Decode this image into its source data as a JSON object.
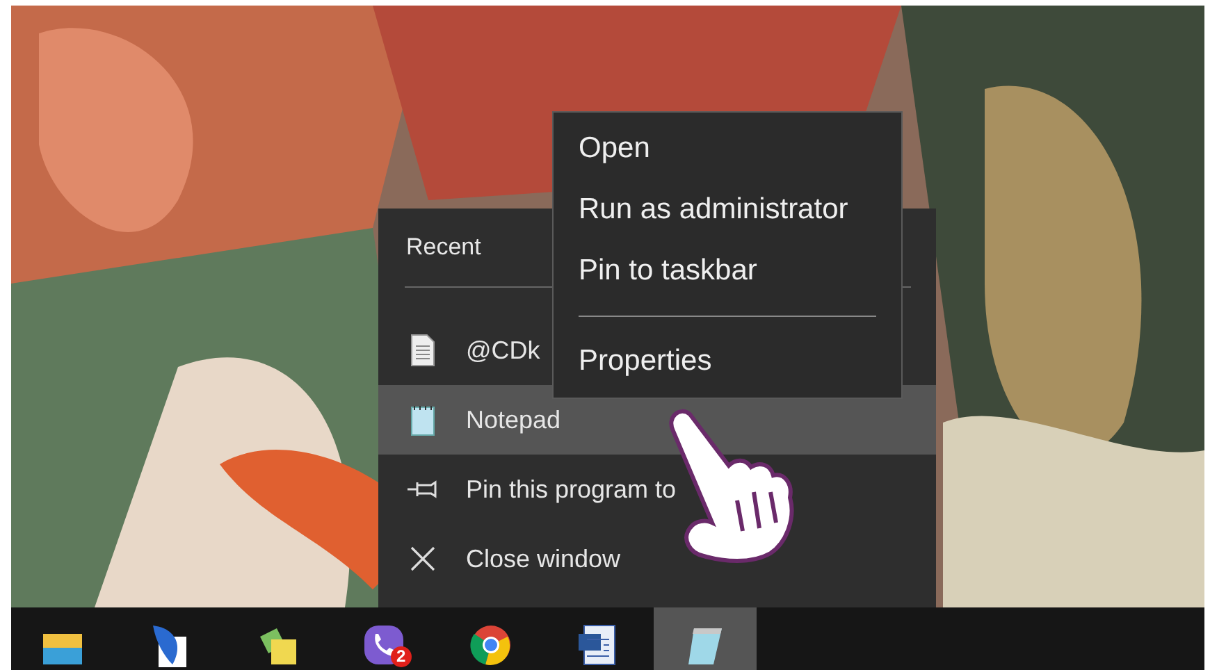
{
  "jump_list": {
    "header": "Recent",
    "items": [
      {
        "kind": "file",
        "label": "@CDk",
        "selected": false
      },
      {
        "kind": "app",
        "label": "Notepad",
        "selected": true
      },
      {
        "kind": "pin",
        "label": "Pin this program to",
        "selected": false
      },
      {
        "kind": "close",
        "label": "Close window",
        "selected": false
      }
    ]
  },
  "context_menu": {
    "items": [
      {
        "kind": "item",
        "label": "Open"
      },
      {
        "kind": "item",
        "label": "Run as administrator"
      },
      {
        "kind": "item",
        "label": "Pin to taskbar"
      },
      {
        "kind": "separator"
      },
      {
        "kind": "item",
        "label": "Properties"
      }
    ]
  },
  "taskbar": {
    "apps": [
      {
        "kind": "folder",
        "active": false
      },
      {
        "kind": "feather",
        "active": false
      },
      {
        "kind": "notes",
        "active": false
      },
      {
        "kind": "phone",
        "active": false,
        "badge": "2"
      },
      {
        "kind": "browser",
        "active": false
      },
      {
        "kind": "document",
        "active": false
      },
      {
        "kind": "notepad",
        "active": true
      }
    ]
  }
}
